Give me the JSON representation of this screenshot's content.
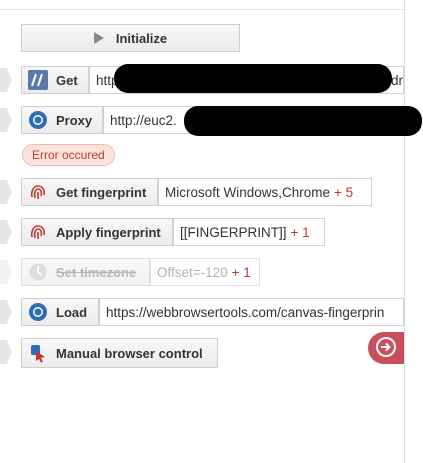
{
  "initialize": {
    "label": "Initialize",
    "icon": "play-icon"
  },
  "steps": {
    "get": {
      "label": "Get",
      "value": "http",
      "value_tail": "dr"
    },
    "proxy": {
      "label": "Proxy",
      "value": "http://euc2."
    },
    "error": {
      "text": "Error occured"
    },
    "get_fingerprint": {
      "label": "Get fingerprint",
      "value": "Microsoft Windows,Chrome",
      "extra": "+ 5"
    },
    "apply_fingerprint": {
      "label": "Apply fingerprint",
      "value": "[[FINGERPRINT]]",
      "extra": "+ 1"
    },
    "set_timezone": {
      "label": "Set timezone",
      "value": "Offset=-120",
      "extra": "+ 1"
    },
    "load": {
      "label": "Load",
      "value": "https://webbrowsertools.com/canvas-fingerprin"
    },
    "manual": {
      "label": "Manual browser control"
    }
  },
  "colors": {
    "accent_red": "#c0392b",
    "round_button": "#c9505a",
    "proxy_blue": "#2d6fb7",
    "get_icon_bg": "#5a78a8"
  }
}
